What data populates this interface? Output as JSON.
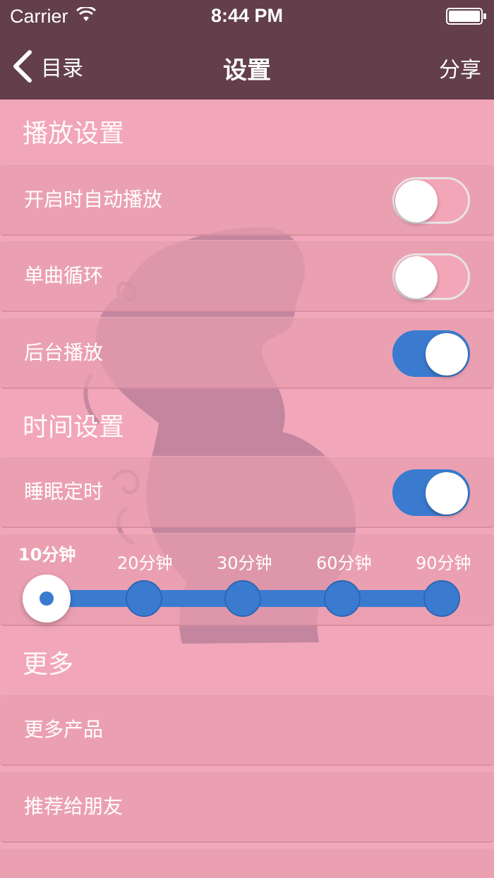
{
  "status_bar": {
    "carrier": "Carrier",
    "time": "8:44 PM"
  },
  "nav": {
    "back_label": "目录",
    "title": "设置",
    "share_label": "分享"
  },
  "sections": {
    "playback": {
      "title": "播放设置",
      "rows": [
        {
          "label": "开启时自动播放",
          "on": false
        },
        {
          "label": "单曲循环",
          "on": false
        },
        {
          "label": "后台播放",
          "on": true
        }
      ]
    },
    "time": {
      "title": "时间设置",
      "sleep_timer": {
        "label": "睡眠定时",
        "on": true
      },
      "timer_options": [
        "10分钟",
        "20分钟",
        "30分钟",
        "60分钟",
        "90分钟"
      ],
      "selected_option": "10分钟"
    },
    "more": {
      "title": "更多",
      "rows": [
        {
          "label": "更多产品"
        },
        {
          "label": "推荐给朋友"
        }
      ]
    }
  },
  "colors": {
    "nav_background": "#633e4b",
    "page_background": "#f2a6b9",
    "accent": "#3a7bd0"
  }
}
